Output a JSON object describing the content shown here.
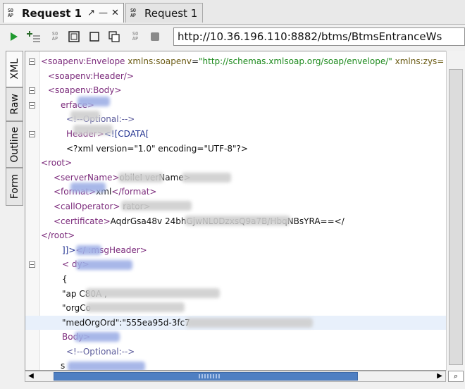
{
  "tabs": [
    {
      "label": "Request 1",
      "active": true,
      "controls": [
        "↗",
        "—",
        "✕"
      ]
    },
    {
      "label": "Request 1",
      "active": false
    }
  ],
  "icons": {
    "soap": [
      "SO",
      "AP"
    ]
  },
  "toolbar": {
    "endpoint": "http://10.36.196.110:8882/btms/BtmsEntranceWs",
    "buttons": [
      "run-icon",
      "add-line-icon",
      "soap-icon",
      "window-icon",
      "square-icon",
      "clone-icon",
      "soap-icon",
      "stop-icon"
    ]
  },
  "side_tabs": [
    "XML",
    "Raw",
    "Outline",
    "Form"
  ],
  "editor": {
    "lines": [
      {
        "indent": 0,
        "fold": true,
        "parts": [
          [
            "tag",
            "<soapenv:Envelope "
          ],
          [
            "attr",
            "xmlns:soapenv"
          ],
          [
            "txt",
            "="
          ],
          [
            "str",
            "\"http://schemas.xmlsoap.org/soap/envelope/\""
          ],
          [
            "txt",
            " "
          ],
          [
            "attr",
            "xmlns:zys="
          ]
        ]
      },
      {
        "indent": 10,
        "fold": false,
        "parts": [
          [
            "tag",
            "<soapenv:Header/>"
          ]
        ]
      },
      {
        "indent": 10,
        "fold": true,
        "parts": [
          [
            "tag",
            "<soapenv:Body>"
          ]
        ]
      },
      {
        "indent": 28,
        "fold": true,
        "parts": [
          [
            "tag",
            "erface>"
          ]
        ]
      },
      {
        "indent": 36,
        "fold": false,
        "parts": [
          [
            "com",
            "<!--Optional:-->"
          ]
        ]
      },
      {
        "indent": 36,
        "fold": true,
        "parts": [
          [
            "tag",
            "Header>"
          ],
          [
            "cdata",
            "<![CDATA["
          ]
        ]
      },
      {
        "indent": 36,
        "fold": false,
        "parts": [
          [
            "txt",
            "<?xml version=\"1.0\" encoding=\"UTF-8\"?>"
          ]
        ]
      },
      {
        "indent": 0,
        "fold": false,
        "parts": [
          [
            "tag",
            "<root>"
          ]
        ]
      },
      {
        "indent": 18,
        "fold": false,
        "parts": [
          [
            "tag",
            "<serverName>"
          ],
          [
            "txt",
            "obileI"
          ],
          [
            "txt",
            "     verName>"
          ]
        ]
      },
      {
        "indent": 18,
        "fold": false,
        "parts": [
          [
            "tag",
            "<format>"
          ],
          [
            "txt",
            "xml"
          ],
          [
            "tag",
            "</format>"
          ]
        ]
      },
      {
        "indent": 18,
        "fold": false,
        "parts": [
          [
            "tag",
            "<callOperator>"
          ],
          [
            "txt",
            "                          rator>"
          ]
        ]
      },
      {
        "indent": 18,
        "fold": false,
        "parts": [
          [
            "tag",
            "<certificate>"
          ],
          [
            "txt",
            "AqdrGsa48v"
          ],
          [
            "txt",
            "                              "
          ],
          [
            "txt",
            "24bhGjwNL0DzxsQ9a7B/HbqNBsYRA==</"
          ]
        ]
      },
      {
        "indent": 0,
        "fold": false,
        "parts": [
          [
            "tag",
            "</root>"
          ]
        ]
      },
      {
        "indent": 30,
        "fold": false,
        "parts": [
          [
            "cdata",
            "]]>"
          ],
          [
            "tag",
            "</"
          ],
          [
            "tag",
            "         :msgHeader>"
          ]
        ]
      },
      {
        "indent": 30,
        "fold": true,
        "parts": [
          [
            "tag",
            "<"
          ],
          [
            "tag",
            "                 dy>"
          ]
        ]
      },
      {
        "indent": 30,
        "fold": false,
        "parts": [
          [
            "txt",
            "{"
          ]
        ]
      },
      {
        "indent": 30,
        "fold": false,
        "parts": [
          [
            "txt",
            "\"ap"
          ],
          [
            "txt",
            "                                       C80A"
          ],
          [
            "txt",
            "                ,"
          ]
        ]
      },
      {
        "indent": 30,
        "fold": false,
        "parts": [
          [
            "txt",
            "\"orgCo"
          ]
        ]
      },
      {
        "indent": 30,
        "fold": false,
        "highlight": true,
        "parts": [
          [
            "txt",
            "\"medOrgOrd\":\"555ea95d-3fc7"
          ]
        ]
      },
      {
        "indent": 30,
        "fold": false,
        "parts": [
          [
            "tag",
            "Body>"
          ]
        ]
      },
      {
        "indent": 36,
        "fold": false,
        "parts": [
          [
            "com",
            "<!--Optional:-->"
          ]
        ]
      },
      {
        "indent": 28,
        "fold": false,
        "parts": [
          [
            "txt",
            "s"
          ]
        ]
      }
    ]
  },
  "colors": {
    "accent": "#4f7fc2",
    "tag": "#7b2a7b",
    "attr": "#6a5a12",
    "string": "#1c8a1c",
    "comment": "#5b5b9b"
  }
}
